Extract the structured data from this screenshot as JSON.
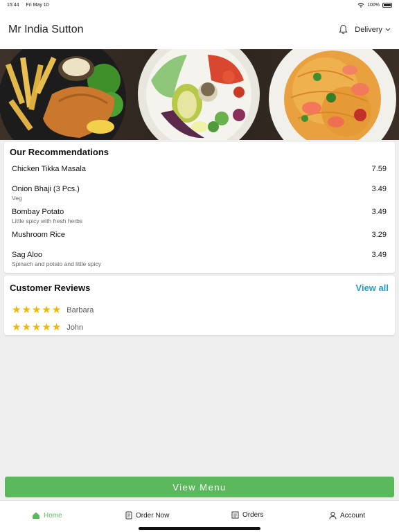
{
  "status_bar": {
    "time": "15:44",
    "date": "Fri May 10",
    "battery": "100%"
  },
  "header": {
    "store_name": "Mr India Sutton",
    "delivery_label": "Delivery"
  },
  "recommendations": {
    "title": "Our Recommendations",
    "items": [
      {
        "name": "Chicken Tikka Masala",
        "description": "",
        "price": "7.59"
      },
      {
        "name": "Onion Bhaji (3 Pcs.)",
        "description": "Veg",
        "price": "3.49"
      },
      {
        "name": "Bombay Potato",
        "description": "Little spicy with fresh herbs",
        "price": "3.49"
      },
      {
        "name": "Mushroom Rice",
        "description": "",
        "price": "3.29"
      },
      {
        "name": "Sag Aloo",
        "description": "Spinach and potato and little spicy",
        "price": "3.49"
      }
    ]
  },
  "reviews": {
    "title": "Customer Reviews",
    "view_all_label": "View all",
    "items": [
      {
        "reviewer": "Barbara",
        "rating": 5
      },
      {
        "reviewer": "John",
        "rating": 5
      }
    ]
  },
  "view_menu_label": "View Menu",
  "tabs": [
    {
      "label": "Home",
      "icon": "home-icon",
      "active": true
    },
    {
      "label": "Order Now",
      "icon": "order-icon",
      "active": false
    },
    {
      "label": "Orders",
      "icon": "orders-icon",
      "active": false
    },
    {
      "label": "Account",
      "icon": "account-icon",
      "active": false
    }
  ],
  "colors": {
    "accent_green": "#5cb85c",
    "link_blue": "#2e9ac4",
    "star_yellow": "#f2b705"
  }
}
